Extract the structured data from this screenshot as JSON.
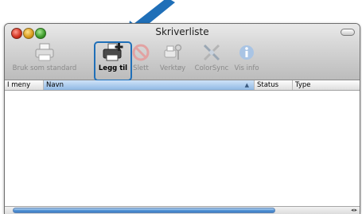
{
  "window": {
    "title": "Skriverliste"
  },
  "toolbar": {
    "items": [
      {
        "label": "Bruk som standard",
        "icon": "printer-icon",
        "enabled": false
      },
      {
        "label": "Legg til",
        "icon": "add-printer-icon",
        "enabled": true
      },
      {
        "label": "Slett",
        "icon": "delete-icon",
        "enabled": false
      },
      {
        "label": "Verktøy",
        "icon": "utility-icon",
        "enabled": false
      },
      {
        "label": "ColorSync",
        "icon": "colorsync-icon",
        "enabled": false
      },
      {
        "label": "Vis info",
        "icon": "info-icon",
        "enabled": false
      }
    ]
  },
  "list": {
    "columns": [
      "I meny",
      "Navn",
      "Status",
      "Type"
    ],
    "sorted_column": "Navn",
    "rows": []
  },
  "colors": {
    "highlight": "#1f6fb8",
    "pointer_arrow": "#1f6fb8",
    "selection_blue": "#4e8ed2"
  }
}
